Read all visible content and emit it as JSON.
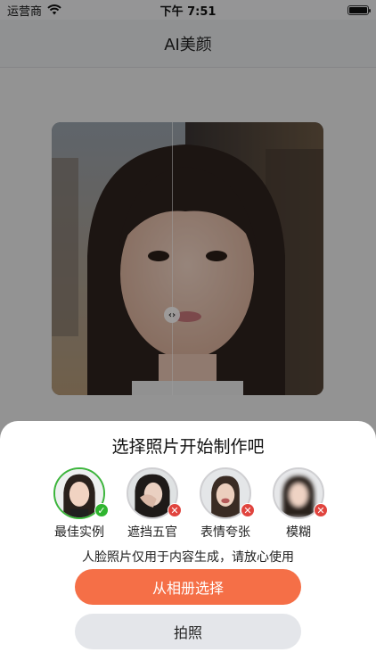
{
  "status_bar": {
    "carrier": "运营商",
    "time": "下午 7:51"
  },
  "nav": {
    "title": "AI美颜"
  },
  "sheet": {
    "title": "选择照片开始制作吧",
    "examples": [
      {
        "label": "最佳实例",
        "status": "ok"
      },
      {
        "label": "遮挡五官",
        "status": "bad"
      },
      {
        "label": "表情夸张",
        "status": "bad"
      },
      {
        "label": "模糊",
        "status": "bad"
      }
    ],
    "privacy_note": "人脸照片仅用于内容生成，请放心使用",
    "album_button": "从相册选择",
    "camera_button": "拍照"
  },
  "colors": {
    "accent": "#f56f47",
    "ok": "#2fb52f",
    "bad": "#e0443e"
  }
}
